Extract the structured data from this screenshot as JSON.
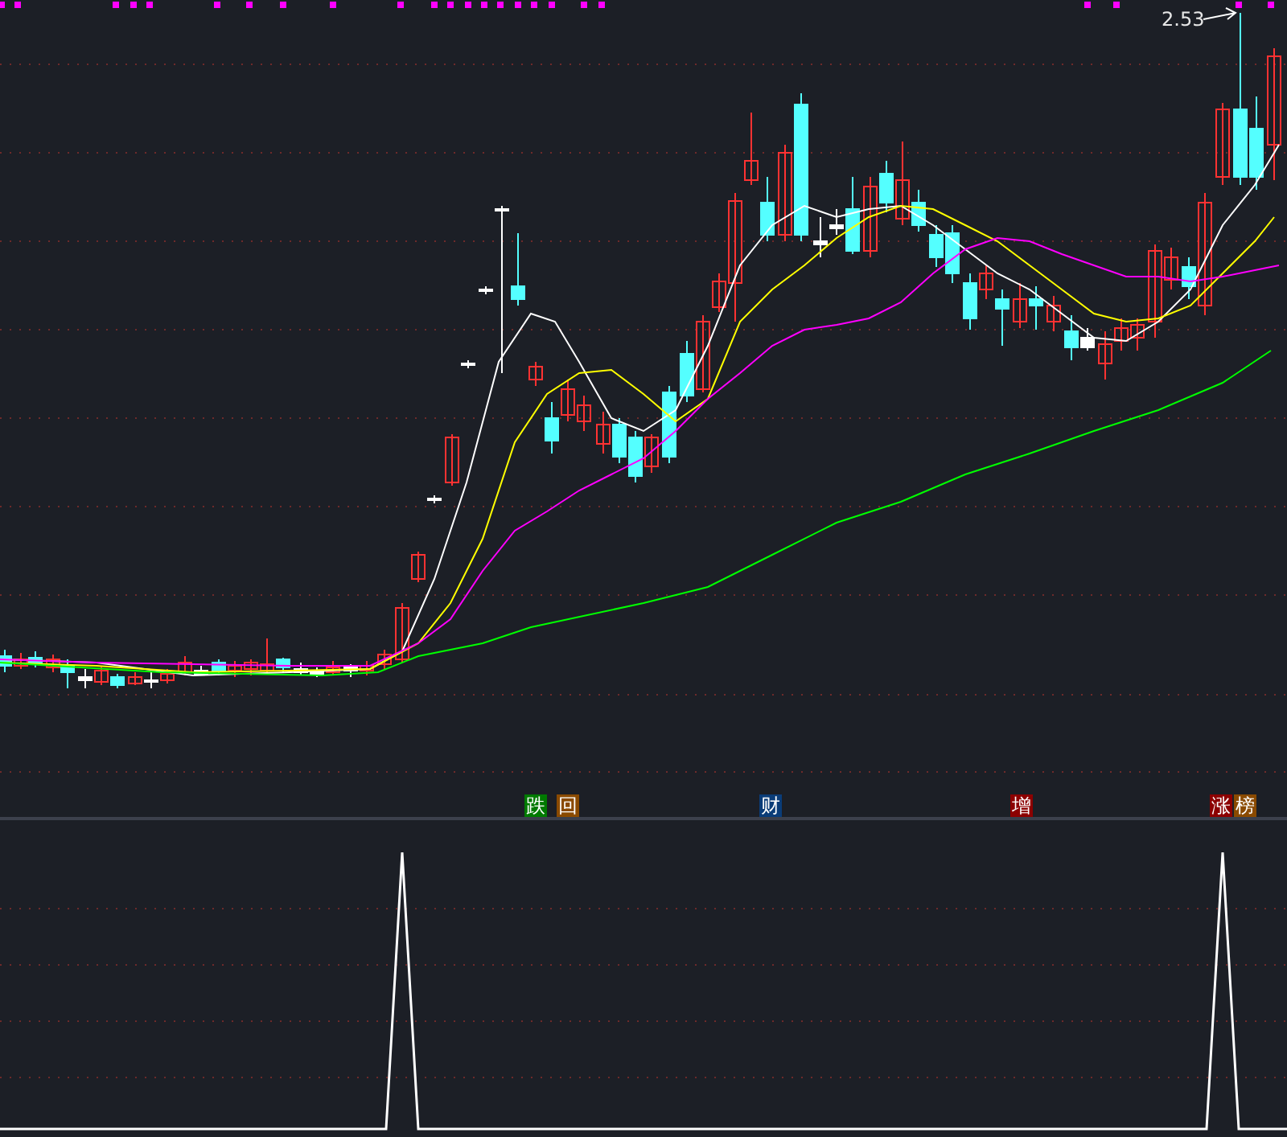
{
  "price_panel": {
    "high_marker": "2.53",
    "signals": [
      {
        "label": "跌",
        "color": "#007a00"
      },
      {
        "label": "回",
        "color": "#8a4a00"
      },
      {
        "label": "财",
        "color": "#0a3c78"
      },
      {
        "label": "增",
        "color": "#8c0000"
      },
      {
        "label": "涨",
        "color": "#8c0000"
      },
      {
        "label": "榜",
        "color": "#8a4a00"
      }
    ]
  }
}
